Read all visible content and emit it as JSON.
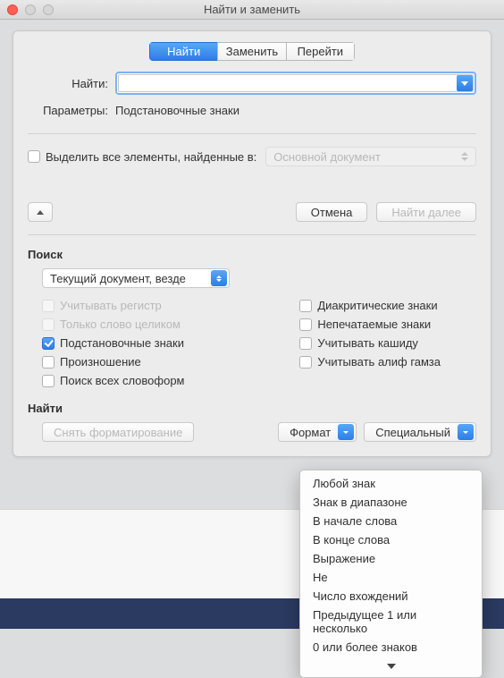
{
  "window": {
    "title": "Найти и заменить"
  },
  "tabs": {
    "find": "Найти",
    "replace": "Заменить",
    "goto": "Перейти"
  },
  "find": {
    "label": "Найти:",
    "value": "",
    "params_label": "Параметры:",
    "params_value": "Подстановочные знаки"
  },
  "highlight": {
    "label": "Выделить все элементы, найденные в:",
    "scope": "Основной документ"
  },
  "buttons": {
    "cancel": "Отмена",
    "find_next": "Найти далее"
  },
  "search_section": {
    "title": "Поиск",
    "scope": "Текущий документ, везде",
    "left": [
      "Учитывать регистр",
      "Только слово целиком",
      "Подстановочные знаки",
      "Произношение",
      "Поиск всех словоформ"
    ],
    "right": [
      "Диакритические знаки",
      "Непечатаемые знаки",
      "Учитывать кашиду",
      "Учитывать алиф гамза"
    ]
  },
  "find_section": {
    "title": "Найти",
    "clear_formatting": "Снять форматирование",
    "format": "Формат",
    "special": "Специальный"
  },
  "special_menu": [
    "Любой знак",
    "Знак в диапазоне",
    "В начале слова",
    "В конце слова",
    "Выражение",
    "Не",
    "Число вхождений",
    "Предыдущее 1 или несколько",
    "0 или более знаков"
  ]
}
